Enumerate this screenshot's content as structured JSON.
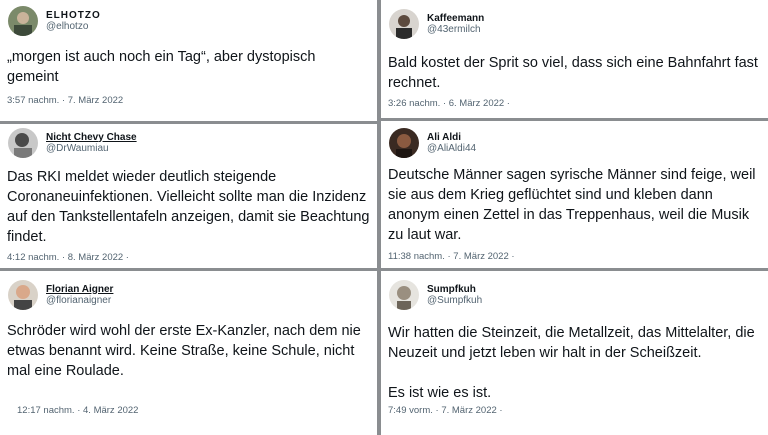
{
  "tweets": [
    {
      "name": "ELHOTZO",
      "handle": "@elhotzo",
      "text": "„morgen ist auch noch ein Tag“, aber dystopisch gemeint",
      "meta": "3:57 nachm. · 7. März 2022"
    },
    {
      "name": "Kaffeemann",
      "handle": "@43ermilch",
      "text": "Bald kostet der Sprit so viel, dass sich eine Bahnfahrt fast rechnet.",
      "meta": "3:26 nachm. · 6. März 2022 ·"
    },
    {
      "name": "Nicht Chevy Chase",
      "handle": "@DrWaumiau",
      "text": "Das RKI meldet wieder deutlich steigende Coronaneuinfektionen. Vielleicht sollte man die Inzidenz auf den Tankstellentafeln anzeigen, damit sie Beachtung findet.",
      "meta": "4:12 nachm. · 8. März 2022 ·"
    },
    {
      "name": "Ali Aldi",
      "handle": "@AliAldi44",
      "text": "Deutsche Männer sagen syrische Männer sind feige, weil sie aus dem Krieg geflüchtet sind und kleben dann anonym einen Zettel in das Treppenhaus, weil die Musik zu laut war.",
      "meta": "11:38 nachm. · 7. März 2022 ·"
    },
    {
      "name": "Florian Aigner",
      "handle": "@florianaigner",
      "text": "Schröder wird wohl der erste Ex-Kanzler, nach dem nie etwas benannt wird. Keine Straße, keine Schule, nicht mal eine Roulade.",
      "meta": "12:17 nachm. · 4. März 2022"
    },
    {
      "name": "Sumpfkuh",
      "handle": "@Sumpfkuh",
      "text": "Wir hatten die Steinzeit, die Metallzeit, das Mittelalter, die Neuzeit und jetzt leben wir halt in der Scheißzeit.\n\nEs ist wie es ist.",
      "meta": "7:49 vorm. · 7. März 2022 ·"
    }
  ]
}
